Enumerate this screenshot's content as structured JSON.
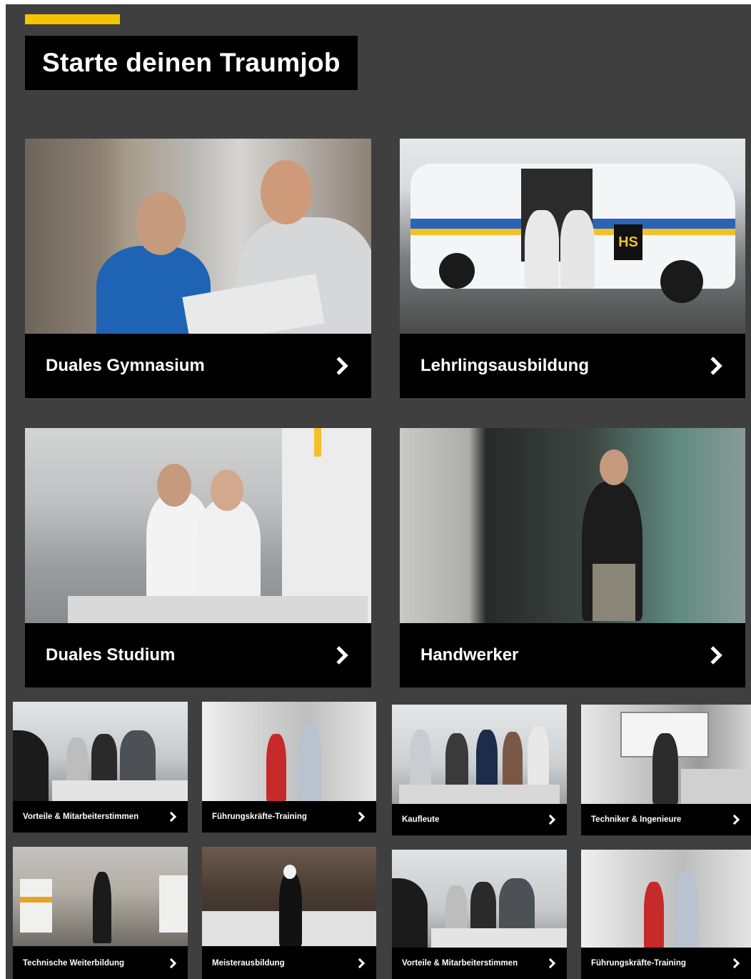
{
  "header": {
    "title": "Starte deinen Traumjob",
    "accent_color": "#f5c400"
  },
  "cards": [
    {
      "label": "Duales Gymnasium"
    },
    {
      "label": "Lehrlingsausbildung"
    },
    {
      "label": "Duales Studium"
    },
    {
      "label": "Handwerker"
    }
  ],
  "small_cards": [
    {
      "label": "Vorteile & Mitarbeiterstimmen"
    },
    {
      "label": "Führungskräfte-Training"
    },
    {
      "label": "Kaufleute"
    },
    {
      "label": "Techniker & Ingenieure"
    },
    {
      "label": "Technische Weiterbildung"
    },
    {
      "label": "Meisterausbildung"
    },
    {
      "label": "Vorteile & Mitarbeiterstimmen"
    },
    {
      "label": "Führungskräfte-Training"
    }
  ],
  "icons": {
    "card_arrow": "chevron-right-icon"
  },
  "van_logo_text": "HS"
}
